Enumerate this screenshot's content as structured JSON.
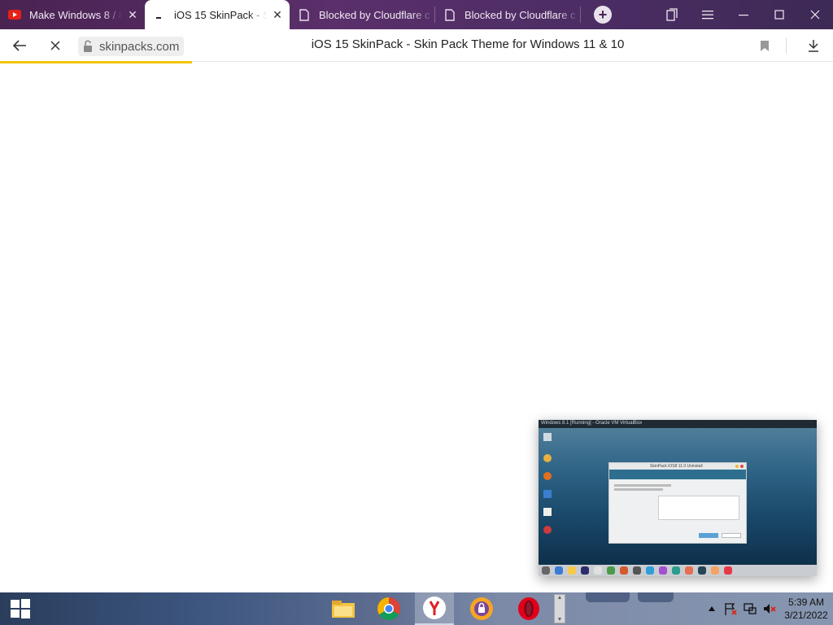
{
  "browser": {
    "tabs": [
      {
        "title": "Make Windows 8 / 8",
        "favicon": "youtube-icon",
        "active": false
      },
      {
        "title": "iOS 15 SkinPack - Sk",
        "favicon": "loading-icon",
        "active": true
      },
      {
        "title": "Blocked by Cloudflare c",
        "favicon": "page-icon",
        "active": false
      },
      {
        "title": "Blocked by Cloudflare c",
        "favicon": "page-icon",
        "active": false
      }
    ],
    "new_tab_label": "+",
    "window_controls": [
      "collections-icon",
      "menu-icon",
      "minimize-icon",
      "maximize-icon",
      "close-icon"
    ]
  },
  "address_bar": {
    "domain": "skinpacks.com",
    "page_title": "iOS 15 SkinPack - Skin Pack Theme for Windows 11 & 10",
    "loading_progress": 0.23
  },
  "preview": {
    "titlebar_text": "Windows 8.1 [Running] - Oracle VM VirtualBox",
    "dialog_title": "SkinPack iOS8 11.0 Uninstall"
  },
  "taskbar": {
    "apps": [
      "file-explorer-icon",
      "chrome-icon",
      "yandex-icon",
      "tor-browser-icon",
      "opera-icon"
    ],
    "time": "5:39 AM",
    "date": "3/21/2022"
  },
  "colors": {
    "tab_bar": "#4a2352",
    "load_bar": "#f2c500",
    "taskbar": "#3e5781"
  }
}
